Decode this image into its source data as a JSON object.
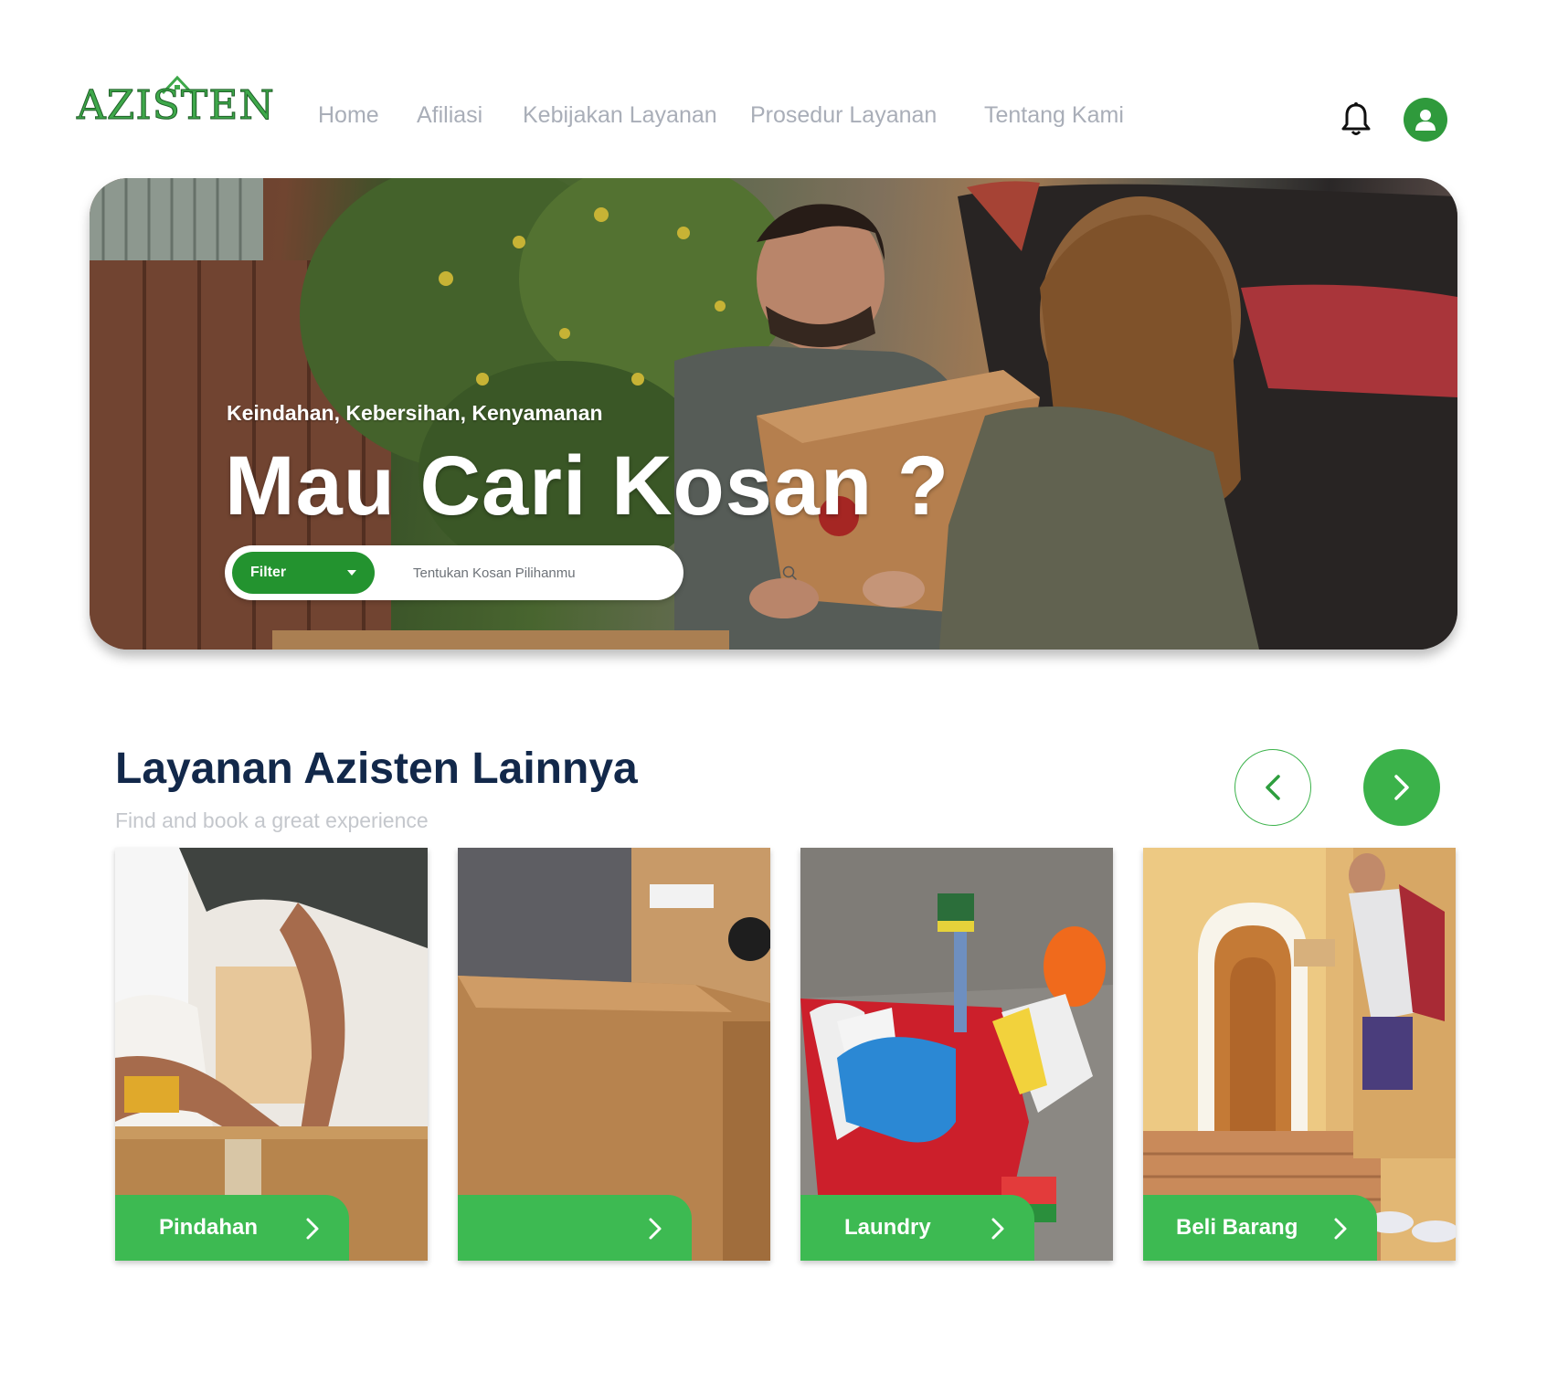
{
  "brand": {
    "logo_text": "AZISTEN"
  },
  "nav": {
    "items": [
      {
        "label": "Home"
      },
      {
        "label": "Afiliasi"
      },
      {
        "label": "Kebijakan Layanan"
      },
      {
        "label": "Prosedur Layanan"
      },
      {
        "label": "Tentang Kami"
      }
    ]
  },
  "header": {
    "notification_icon": "bell-icon",
    "profile_icon": "user-icon"
  },
  "hero": {
    "tagline": "Keindahan, Kebersihan, Kenyamanan",
    "title": "Mau Cari Kosan ?",
    "filter_label": "Filter",
    "search_placeholder": "Tentukan Kosan Pilihanmu"
  },
  "services": {
    "title": "Layanan Azisten Lainnya",
    "subtitle": "Find and book a great experience",
    "cards": [
      {
        "label": "Pindahan"
      },
      {
        "label": ""
      },
      {
        "label": "Laundry"
      },
      {
        "label": "Beli Barang"
      }
    ]
  },
  "colors": {
    "brand_green": "#3ea84a",
    "button_green": "#3bb24a",
    "filter_green": "#23932f",
    "heading_navy": "#12284a",
    "nav_gray": "#a9aeb8"
  }
}
